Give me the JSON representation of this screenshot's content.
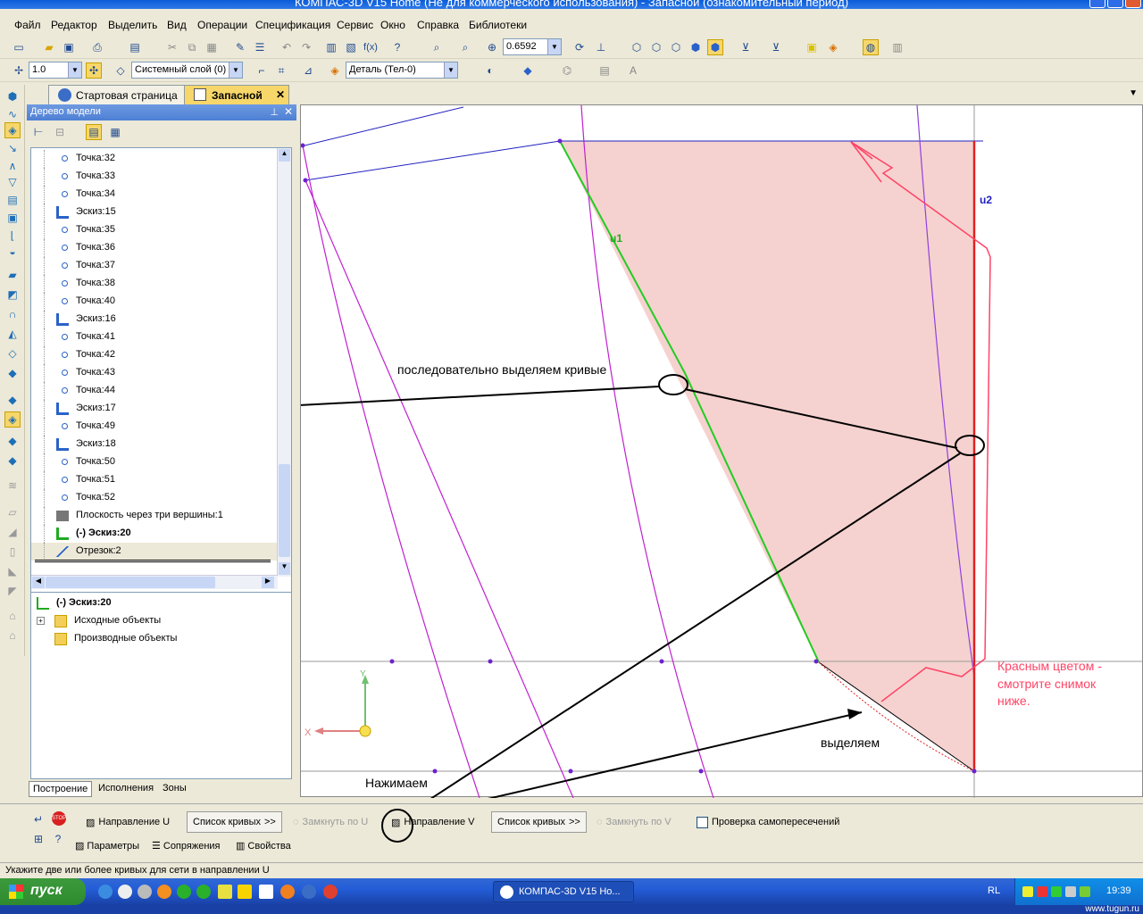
{
  "title": "КОМПАС-3D V15 Home (Не для коммерческого использования) - Запасной (ознакомительный период)",
  "menu": [
    "Файл",
    "Редактор",
    "Выделить",
    "Вид",
    "Операции",
    "Спецификация",
    "Сервис",
    "Окно",
    "Справка",
    "Библиотеки"
  ],
  "toolbar1": {
    "zoom_value": "0.6592"
  },
  "toolbar2": {
    "line_width": "1.0",
    "layer": "Системный слой (0)",
    "detail": "Деталь (Тел-0)"
  },
  "tabs": {
    "start": "Стартовая страница",
    "active": "Запасной"
  },
  "tree": {
    "header": "Дерево модели",
    "items": [
      {
        "type": "point",
        "label": "Точка:32"
      },
      {
        "type": "point",
        "label": "Точка:33"
      },
      {
        "type": "point",
        "label": "Точка:34"
      },
      {
        "type": "sketch",
        "label": "Эскиз:15"
      },
      {
        "type": "point",
        "label": "Точка:35"
      },
      {
        "type": "point",
        "label": "Точка:36"
      },
      {
        "type": "point",
        "label": "Точка:37"
      },
      {
        "type": "point",
        "label": "Точка:38"
      },
      {
        "type": "point",
        "label": "Точка:40"
      },
      {
        "type": "sketch",
        "label": "Эскиз:16"
      },
      {
        "type": "point",
        "label": "Точка:41"
      },
      {
        "type": "point",
        "label": "Точка:42"
      },
      {
        "type": "point",
        "label": "Точка:43"
      },
      {
        "type": "point",
        "label": "Точка:44"
      },
      {
        "type": "sketch",
        "label": "Эскиз:17"
      },
      {
        "type": "point",
        "label": "Точка:49"
      },
      {
        "type": "sketch",
        "label": "Эскиз:18"
      },
      {
        "type": "point",
        "label": "Точка:50"
      },
      {
        "type": "point",
        "label": "Точка:51"
      },
      {
        "type": "point",
        "label": "Точка:52"
      },
      {
        "type": "plane",
        "label": "Плоскость через три вершины:1"
      },
      {
        "type": "sketch-active",
        "label": "(-) Эскиз:20"
      },
      {
        "type": "segment",
        "label": "Отрезок:2"
      }
    ],
    "sub_title": "(-) Эскиз:20",
    "sub_items": [
      "Исходные объекты",
      "Производные объекты"
    ],
    "bottom_tabs": [
      "Построение",
      "Исполнения",
      "Зоны"
    ]
  },
  "canvas": {
    "label_u1": "u1",
    "label_u2": "u2",
    "axis_x": "X",
    "axis_y": "Y",
    "annotation_select_curves": "последовательно выделяем кривые",
    "annotation_red": [
      "Красным цветом -",
      "смотрите снимок",
      "ниже."
    ],
    "annotation_select": "выделяем",
    "annotation_press": "Нажимаем"
  },
  "propbar": {
    "dir_u": "Направление U",
    "curves_u": "Список кривых",
    "close_u": "Замкнуть по U",
    "dir_v": "Направление V",
    "curves_v": "Список кривых",
    "close_v": "Замкнуть по V",
    "self_check": "Проверка самопересечений",
    "tabs": [
      "Параметры",
      "Сопряжения",
      "Свойства"
    ]
  },
  "status": "Укажите две или более кривых для сети в направлении U",
  "taskbar": {
    "start": "пуск",
    "task": "КОМПАС-3D V15 Но...",
    "lang": "RL",
    "time": "19:39"
  },
  "watermark": "www.tugun.ru"
}
